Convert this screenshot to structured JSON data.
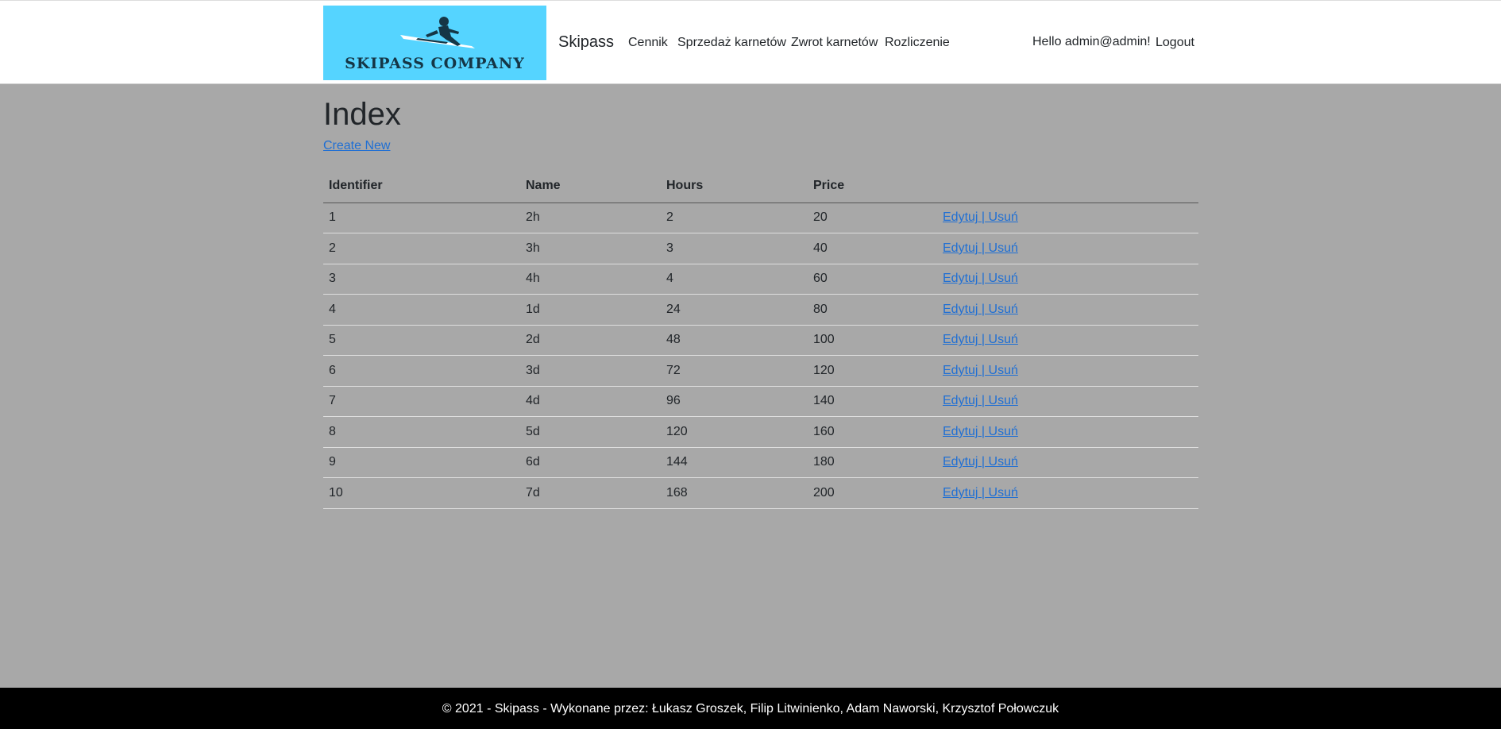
{
  "header": {
    "logo_text": "SKIPASS COMPANY",
    "brand": "Skipass",
    "nav": [
      "Cennik",
      "Sprzedaż karnetów",
      "Zwrot karnetów",
      "Rozliczenie"
    ],
    "user_hello": "Hello admin@admin!",
    "logout": "Logout"
  },
  "main": {
    "title": "Index",
    "create_new": "Create New",
    "columns": [
      "Identifier",
      "Name",
      "Hours",
      "Price"
    ],
    "rows": [
      {
        "id": "1",
        "name": "2h",
        "hours": "2",
        "price": "20"
      },
      {
        "id": "2",
        "name": "3h",
        "hours": "3",
        "price": "40"
      },
      {
        "id": "3",
        "name": "4h",
        "hours": "4",
        "price": "60"
      },
      {
        "id": "4",
        "name": "1d",
        "hours": "24",
        "price": "80"
      },
      {
        "id": "5",
        "name": "2d",
        "hours": "48",
        "price": "100"
      },
      {
        "id": "6",
        "name": "3d",
        "hours": "72",
        "price": "120"
      },
      {
        "id": "7",
        "name": "4d",
        "hours": "96",
        "price": "140"
      },
      {
        "id": "8",
        "name": "5d",
        "hours": "120",
        "price": "160"
      },
      {
        "id": "9",
        "name": "6d",
        "hours": "144",
        "price": "180"
      },
      {
        "id": "10",
        "name": "7d",
        "hours": "168",
        "price": "200"
      }
    ],
    "edit_label": "Edytuj",
    "separator": "|",
    "delete_label": "Usuń"
  },
  "footer": {
    "text": "© 2021 - Skipass - Wykonane przez: Łukasz Groszek, Filip Litwinienko, Adam Naworski, Krzysztof Połowczuk"
  },
  "colors": {
    "page_bg": "#a8a8a8",
    "logo_bg": "#55d4ff",
    "link": "#1f6fd4",
    "footer_bg": "#000000"
  }
}
